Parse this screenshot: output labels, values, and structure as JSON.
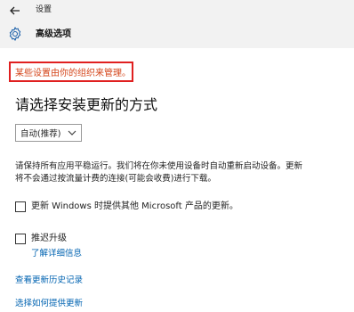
{
  "window": {
    "title": "设置"
  },
  "header": {
    "title": "高级选项"
  },
  "notice": {
    "text": "某些设置由你的组织来管理。"
  },
  "section": {
    "heading": "请选择安装更新的方式"
  },
  "install_mode": {
    "selected": "自动(推荐)"
  },
  "description": "请保持所有应用平稳运行。我们将在你未使用设备时自动重新启动设备。更新将不会通过按流量计费的连接(可能会收费)进行下载。",
  "options": [
    {
      "label": "更新 Windows 时提供其他 Microsoft 产品的更新。",
      "checked": false
    },
    {
      "label": "推迟升级",
      "checked": false
    }
  ],
  "learn_more_link": "了解详细信息",
  "links": {
    "update_history": "查看更新历史记录",
    "choose_delivery": "选择如何提供更新"
  },
  "colors": {
    "notice_text": "#d4451a",
    "highlight_border": "#e02020",
    "link": "#0063b1"
  },
  "icons": {
    "back": "back-arrow-icon",
    "settings": "gear-icon",
    "dropdown": "chevron-down-icon"
  }
}
